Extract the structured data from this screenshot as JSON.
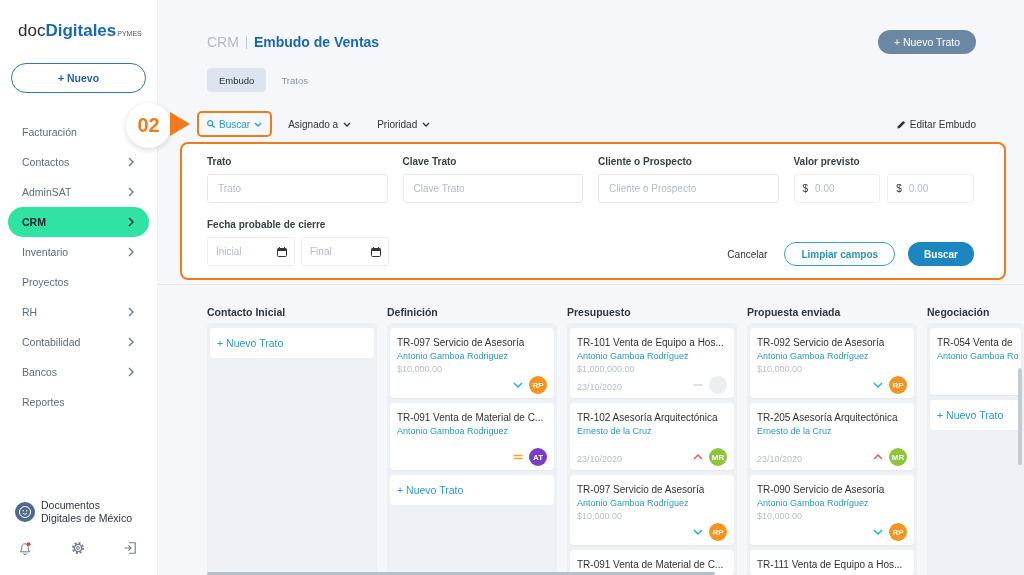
{
  "sidebar": {
    "logo": {
      "prefix": "doc",
      "name": "Digitales",
      "suffix": "PYMES"
    },
    "new_button": "+ Nuevo",
    "items": [
      {
        "label": "Facturación",
        "expandable": false,
        "selected": false
      },
      {
        "label": "Contactos",
        "expandable": true,
        "selected": false
      },
      {
        "label": "AdminSAT",
        "expandable": true,
        "selected": false
      },
      {
        "label": "CRM",
        "expandable": true,
        "selected": true
      },
      {
        "label": "Inventario",
        "expandable": true,
        "selected": false
      },
      {
        "label": "Proyectos",
        "expandable": false,
        "selected": false
      },
      {
        "label": "RH",
        "expandable": true,
        "selected": false
      },
      {
        "label": "Contabilidad",
        "expandable": true,
        "selected": false
      },
      {
        "label": "Bancos",
        "expandable": true,
        "selected": false
      },
      {
        "label": "Reportes",
        "expandable": false,
        "selected": false
      }
    ],
    "account": "Documentos Digitales de México",
    "notifications": true
  },
  "header": {
    "breadcrumb": "CRM",
    "title": "Embudo de Ventas",
    "new_deal_button": "+ Nuevo Trato"
  },
  "tabs": [
    {
      "label": "Embudo",
      "selected": true
    },
    {
      "label": "Tratos",
      "selected": false
    }
  ],
  "filters": {
    "items": [
      {
        "label": "Buscar",
        "kind": "search",
        "highlighted": true
      },
      {
        "label": "Asignado a",
        "kind": "dropdown",
        "highlighted": false
      },
      {
        "label": "Prioridad",
        "kind": "dropdown",
        "highlighted": false
      }
    ],
    "edit_button": "Editar Embudo"
  },
  "annotation": {
    "step": "02"
  },
  "search_panel": {
    "highlighted": true,
    "rows": [
      {
        "fields": [
          {
            "label": "Trato",
            "kind": "text",
            "placeholder": "Trato"
          },
          {
            "label": "Clave Trato",
            "kind": "text",
            "placeholder": "Clave Trato"
          },
          {
            "label": "Cliente o Prospecto",
            "kind": "text",
            "placeholder": "Cliente o Prospecto"
          },
          {
            "label": "Valor previsto",
            "kind": "range",
            "inputs": [
              {
                "prefix": "$",
                "placeholder": "0.00"
              },
              {
                "prefix": "$",
                "placeholder": "0.00"
              }
            ]
          }
        ]
      },
      {
        "fields": [
          {
            "label": "Fecha probable de cierre",
            "kind": "dates",
            "inputs": [
              {
                "placeholder": "Inicial"
              },
              {
                "placeholder": "Final"
              }
            ]
          }
        ]
      }
    ],
    "buttons": [
      {
        "label": "Cancelar",
        "kind": "text"
      },
      {
        "label": "Limpiar campos",
        "kind": "outline"
      },
      {
        "label": "Buscar",
        "kind": "primary"
      }
    ]
  },
  "board": {
    "columns": [
      {
        "title": "Contacto Inicial",
        "cards": [
          {
            "kind": "add",
            "label": "+ Nuevo Trato"
          }
        ]
      },
      {
        "title": "Definición",
        "cards": [
          {
            "kind": "deal",
            "title": "TR-097 Servicio de Asesoría",
            "contact": "Antonio Gamboa Rodriguez",
            "amount": "$10,000.00",
            "priority": {
              "kind": "low"
            },
            "avatar": {
              "initials": "RP",
              "color": "#f7931e"
            }
          },
          {
            "kind": "deal",
            "title": "TR-091 Venta de Material de C...",
            "contact": "Antonio Gamboa Rodriguez",
            "priority": {
              "kind": "medium"
            },
            "avatar": {
              "initials": "AT",
              "color": "#7a3cc6"
            }
          },
          {
            "kind": "add",
            "label": "+ Nuevo Trato"
          }
        ]
      },
      {
        "title": "Presupuesto",
        "cards": [
          {
            "kind": "deal",
            "title": "TR-101 Venta de Equipo a Hos...",
            "contact": "Antonio Gamboa Rodríguez",
            "amount": "$1,000,000.00",
            "date": "23/10/2020",
            "priority": {
              "kind": "none"
            },
            "avatar": {
              "color": "#eceef1"
            }
          },
          {
            "kind": "deal",
            "title": "TR-102 Asesoría Arquitectónica",
            "contact": "Ernesto de la Cruz",
            "date": "23/10/2020",
            "priority": {
              "kind": "high"
            },
            "avatar": {
              "initials": "MR",
              "color": "#8cc63f"
            }
          },
          {
            "kind": "deal",
            "title": "TR-097 Servicio de Asesoría",
            "contact": "Antonio Gamboa Rodríguez",
            "amount": "$10,000.00",
            "priority": {
              "kind": "low"
            },
            "avatar": {
              "initials": "RP",
              "color": "#f7931e"
            }
          },
          {
            "kind": "deal",
            "title": "TR-091 Venta de Material de C..."
          }
        ]
      },
      {
        "title": "Propuesta enviada",
        "cards": [
          {
            "kind": "deal",
            "title": "TR-092 Servicio de Asesoría",
            "contact": "Antonio Gamboa Rodríguez",
            "amount": "$10,000.00",
            "priority": {
              "kind": "low"
            },
            "avatar": {
              "initials": "RP",
              "color": "#f7931e"
            }
          },
          {
            "kind": "deal",
            "title": "TR-205 Asesoría Arquitectónica",
            "contact": "Ernesto de la Cruz",
            "date": "23/10/2020",
            "priority": {
              "kind": "high"
            },
            "avatar": {
              "initials": "MR",
              "color": "#8cc63f"
            }
          },
          {
            "kind": "deal",
            "title": "TR-090 Servicio de Asesoría",
            "contact": "Antonio Gamboa Rodríguez",
            "amount": "$10,000.00",
            "priority": {
              "kind": "low"
            },
            "avatar": {
              "initials": "RP",
              "color": "#f7931e"
            }
          },
          {
            "kind": "deal",
            "title": "TR-111 Venta de Equipo a Hos..."
          }
        ]
      },
      {
        "title": "Negociación",
        "cards": [
          {
            "kind": "deal",
            "title": "TR-054 Venta de",
            "contact": "Antonio Gamboa Ro"
          },
          {
            "kind": "add",
            "label": "+ Nuevo Trato"
          }
        ]
      }
    ]
  }
}
